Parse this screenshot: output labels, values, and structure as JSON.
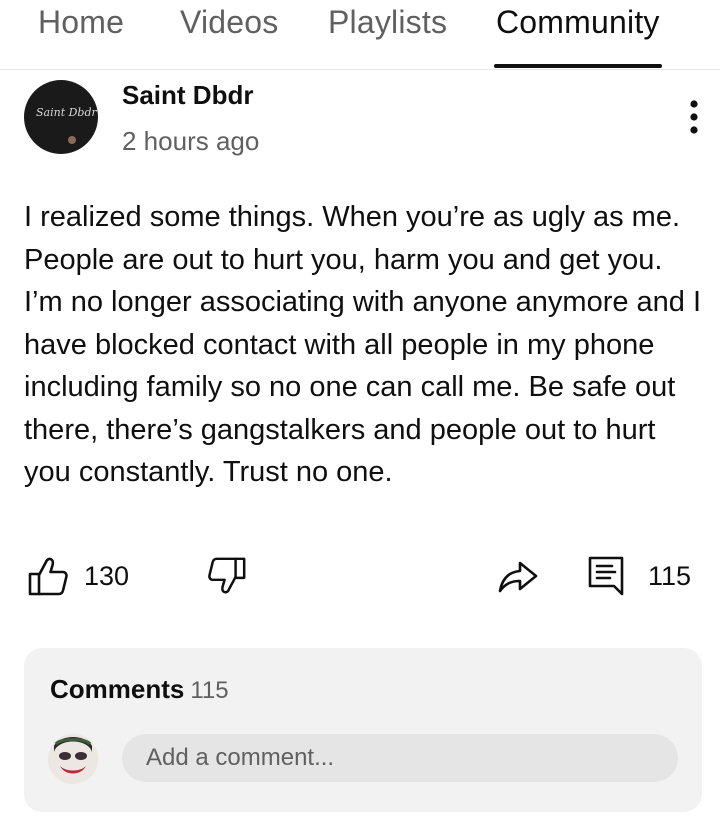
{
  "tabs": [
    {
      "label": "Home",
      "active": false
    },
    {
      "label": "Videos",
      "active": false
    },
    {
      "label": "Playlists",
      "active": false
    },
    {
      "label": "Community",
      "active": true
    }
  ],
  "post": {
    "author": "Saint Dbdr",
    "avatar_text": "Saint Dbdr",
    "time": "2 hours ago",
    "text": "I realized some things. When you’re as ugly as me. People are out to hurt you, harm you and get you. I’m no longer associating with anyone anymore and I have blocked contact with all people in my phone including family so no one can call me. Be safe out there, there’s gangstalkers and people out to hurt you constantly. Trust no one.",
    "likes": "130",
    "comments_count": "115"
  },
  "icons": {
    "like": "thumbs-up-icon",
    "dislike": "thumbs-down-icon",
    "share": "share-icon",
    "comment": "comment-icon",
    "more": "more-vertical-icon"
  },
  "comments": {
    "title": "Comments",
    "count": "115",
    "placeholder": "Add a comment..."
  },
  "colors": {
    "text_primary": "#0f0f0f",
    "text_secondary": "#606060",
    "card_bg": "#f2f2f2",
    "input_bg": "#e5e5e5"
  }
}
